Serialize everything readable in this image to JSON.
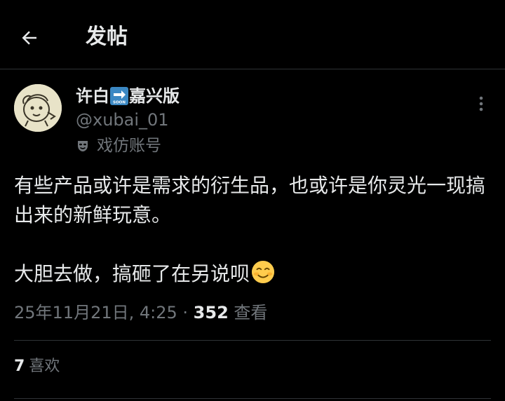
{
  "header": {
    "title": "发帖",
    "back_icon": "arrow-left-icon"
  },
  "author": {
    "name_part1": "许白",
    "name_badge": "SOON",
    "name_part2": "嘉兴版",
    "handle": "@xubai_01",
    "parody_icon": "theater-mask-icon",
    "parody_label": "戏仿账号"
  },
  "post": {
    "text": "有些产品或许是需求的衍生品，也或许是你灵光一现搞出来的新鲜玩意。\n\n大胆去做，搞砸了在另说呗",
    "emoji": "smiling-face-icon"
  },
  "meta": {
    "timestamp": "25年11月21日, 4:25",
    "separator": " · ",
    "views": "352",
    "views_label": "查看"
  },
  "engagement": {
    "likes": "7",
    "likes_label": "喜欢"
  },
  "colors": {
    "background": "#000000",
    "text_primary": "#e7e9ea",
    "text_secondary": "#71767b",
    "divider": "#2f3336",
    "badge_blue": "#3b88c3"
  }
}
